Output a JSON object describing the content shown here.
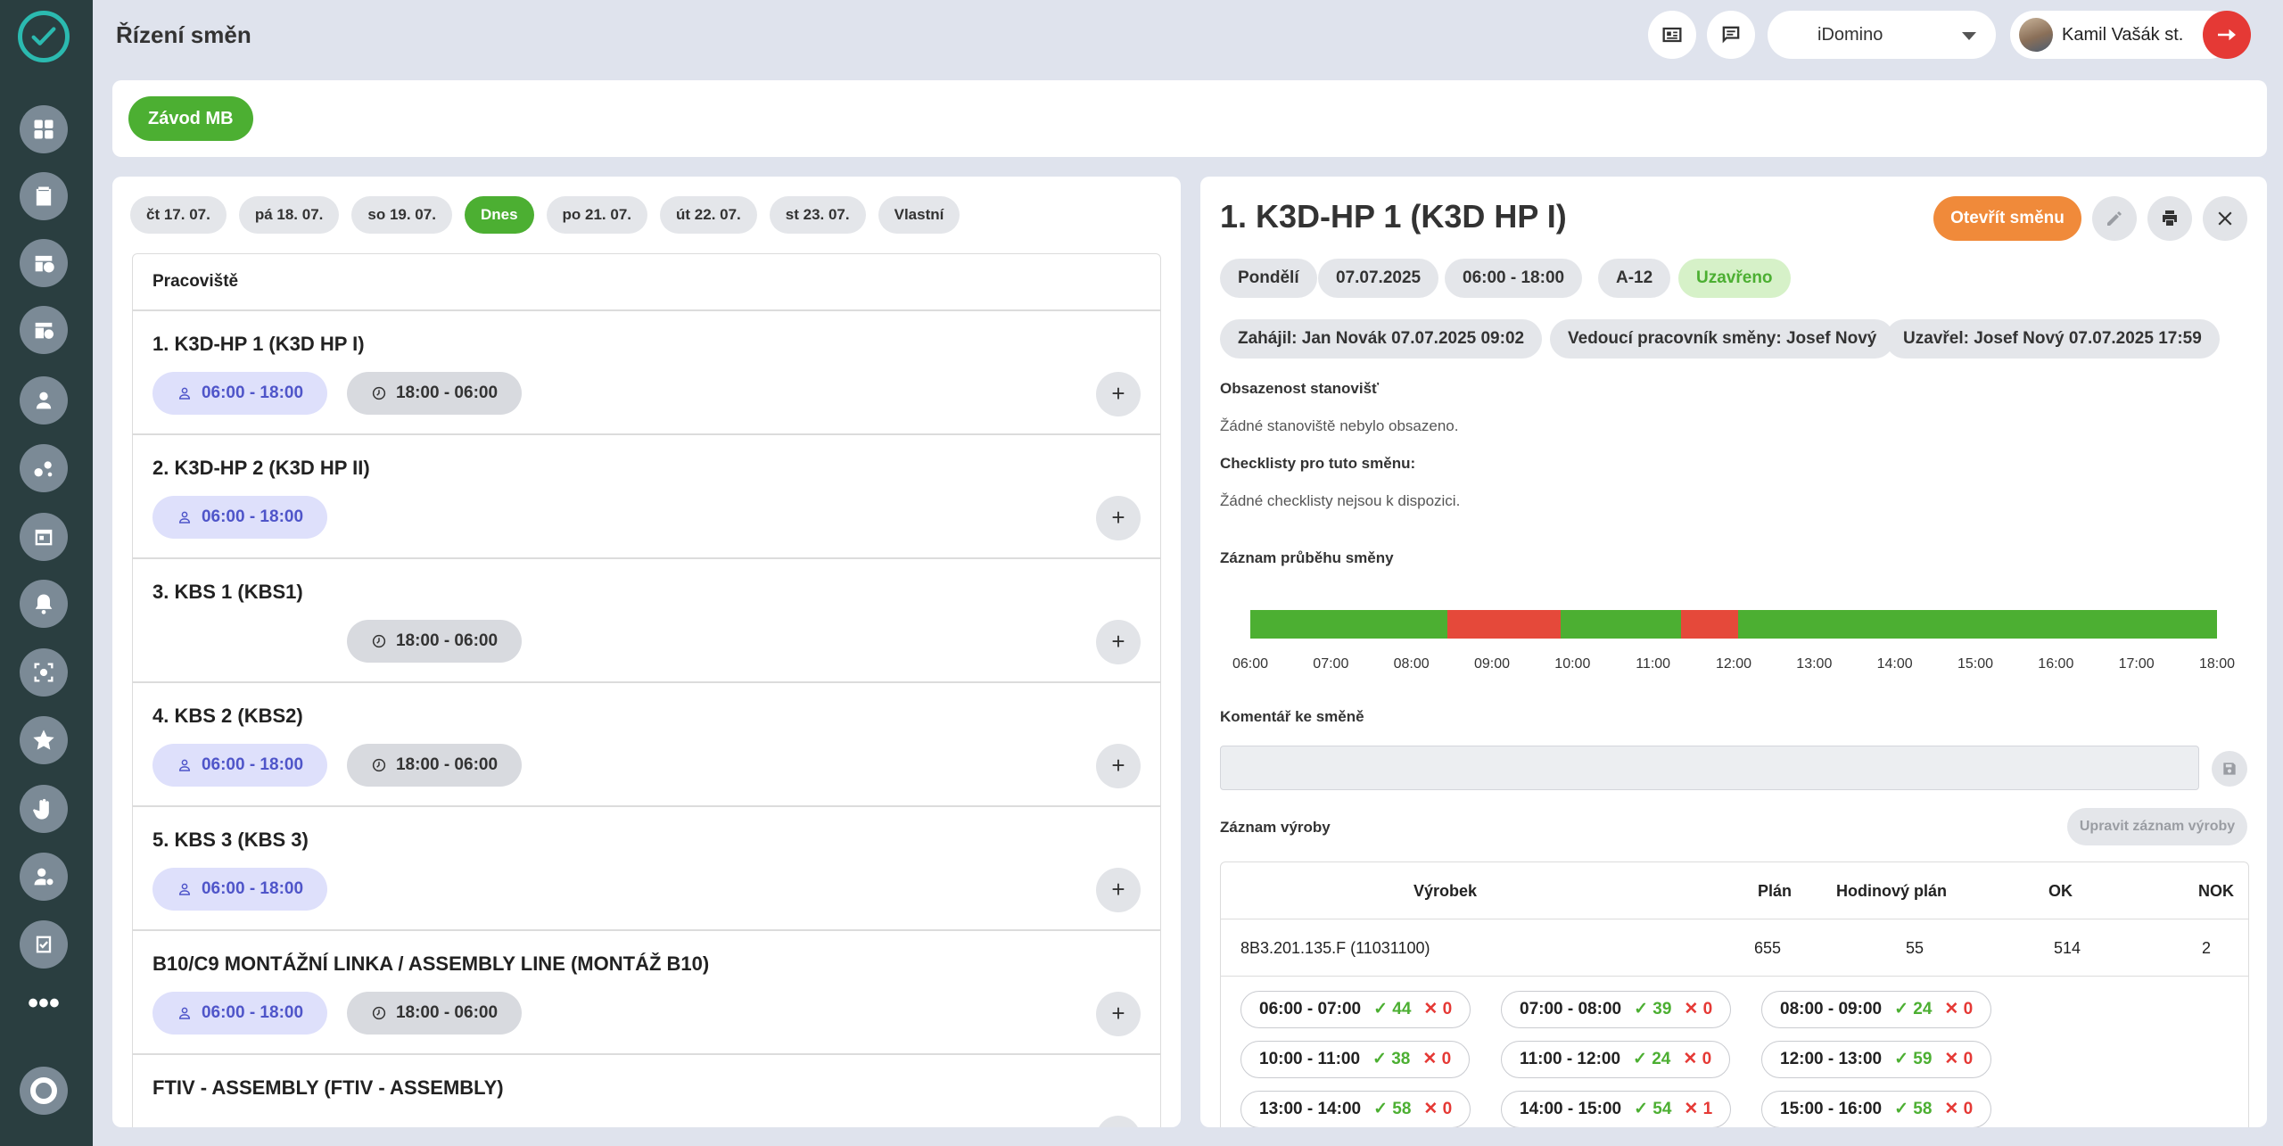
{
  "header": {
    "title": "Řízení směn",
    "org_select": "iDomino",
    "user_name": "Kamil Vašák st."
  },
  "plant": {
    "label": "Závod MB"
  },
  "date_tabs": [
    "čt 17. 07.",
    "pá 18. 07.",
    "so 19. 07.",
    "Dnes",
    "po 21. 07.",
    "út 22. 07.",
    "st 23. 07.",
    "Vlastní"
  ],
  "workstations": {
    "header": "Pracoviště",
    "rows": [
      {
        "name": "1. K3D-HP 1 (K3D HP I)",
        "day": "06:00 - 18:00",
        "night": "18:00 - 06:00"
      },
      {
        "name": "2. K3D-HP 2 (K3D HP II)",
        "day": "06:00 - 18:00",
        "night": ""
      },
      {
        "name": "3. KBS 1 (KBS1)",
        "day": "",
        "night": "18:00 - 06:00"
      },
      {
        "name": "4. KBS 2 (KBS2)",
        "day": "06:00 - 18:00",
        "night": "18:00 - 06:00"
      },
      {
        "name": "5. KBS 3 (KBS 3)",
        "day": "06:00 - 18:00",
        "night": ""
      },
      {
        "name": "B10/C9 MONTÁŽNÍ LINKA / ASSEMBLY LINE (MONTÁŽ B10)",
        "day": "06:00 - 18:00",
        "night": "18:00 - 06:00"
      },
      {
        "name": "FTIV - ASSEMBLY (FTIV - ASSEMBLY)",
        "day": "",
        "night": ""
      }
    ]
  },
  "detail": {
    "title": "1. K3D-HP 1 (K3D HP I)",
    "open_button": "Otevřít směnu",
    "tags": {
      "day": "Pondělí",
      "date": "07.07.2025",
      "time": "06:00 - 18:00",
      "code": "A-12",
      "status": "Uzavřeno",
      "started": "Zahájil: Jan Novák 07.07.2025 09:02",
      "leader": "Vedoucí pracovník směny: Josef Nový",
      "closed": "Uzavřel: Josef Nový 07.07.2025 17:59"
    },
    "occupancy_label": "Obsazenost stanovišť",
    "occupancy_text": "Žádné stanoviště nebylo obsazeno.",
    "checklists_label": "Checklisty pro tuto směnu:",
    "checklists_text": "Žádné checklisty nejsou k dispozici.",
    "timeline_label": "Záznam průběhu směny",
    "timeline": {
      "ticks": [
        "06:00",
        "07:00",
        "08:00",
        "09:00",
        "10:00",
        "11:00",
        "12:00",
        "13:00",
        "14:00",
        "15:00",
        "16:00",
        "17:00",
        "18:00"
      ],
      "segments": [
        {
          "from": 6.0,
          "to": 8.45,
          "state": "ok",
          "color": "#4caf32"
        },
        {
          "from": 8.45,
          "to": 9.85,
          "state": "stop",
          "color": "#e5493a"
        },
        {
          "from": 9.85,
          "to": 11.35,
          "state": "ok",
          "color": "#4caf32"
        },
        {
          "from": 11.35,
          "to": 12.05,
          "state": "stop",
          "color": "#e5493a"
        },
        {
          "from": 12.05,
          "to": 18.0,
          "state": "ok",
          "color": "#4caf32"
        }
      ]
    },
    "comment_label": "Komentář ke směně",
    "production_label": "Záznam výroby",
    "edit_production_button": "Upravit záznam výroby",
    "production_table": {
      "headers": {
        "product": "Výrobek",
        "plan": "Plán",
        "hourly_plan": "Hodinový plán",
        "ok": "OK",
        "nok": "NOK"
      },
      "rows": [
        {
          "product": "8B3.201.135.F (11031100)",
          "plan": "655",
          "hourly_plan": "55",
          "ok": "514",
          "nok": "2"
        }
      ]
    },
    "hourly": [
      {
        "time": "06:00 - 07:00",
        "ok": "44",
        "nok": "0"
      },
      {
        "time": "07:00 - 08:00",
        "ok": "39",
        "nok": "0"
      },
      {
        "time": "08:00 - 09:00",
        "ok": "24",
        "nok": "0"
      },
      {
        "time": "10:00 - 11:00",
        "ok": "38",
        "nok": "0"
      },
      {
        "time": "11:00 - 12:00",
        "ok": "24",
        "nok": "0"
      },
      {
        "time": "12:00 - 13:00",
        "ok": "59",
        "nok": "0"
      },
      {
        "time": "13:00 - 14:00",
        "ok": "58",
        "nok": "0"
      },
      {
        "time": "14:00 - 15:00",
        "ok": "54",
        "nok": "1"
      },
      {
        "time": "15:00 - 16:00",
        "ok": "58",
        "nok": "0"
      }
    ]
  },
  "icons": {
    "sidebar": [
      "dashboard-icon",
      "clipboard-icon",
      "calendar-clock-icon",
      "schedule-icon",
      "operator-icon",
      "molecule-icon",
      "calendar-icon",
      "bell-icon",
      "inspect-icon",
      "star-icon",
      "hand-icon",
      "user-settings-icon",
      "checklist-icon",
      "more-icon",
      "settings-ring-icon"
    ],
    "header": [
      "news-icon",
      "chat-icon",
      "logout-icon"
    ],
    "day_shift": "person-icon",
    "night_shift": "clock-icon"
  }
}
